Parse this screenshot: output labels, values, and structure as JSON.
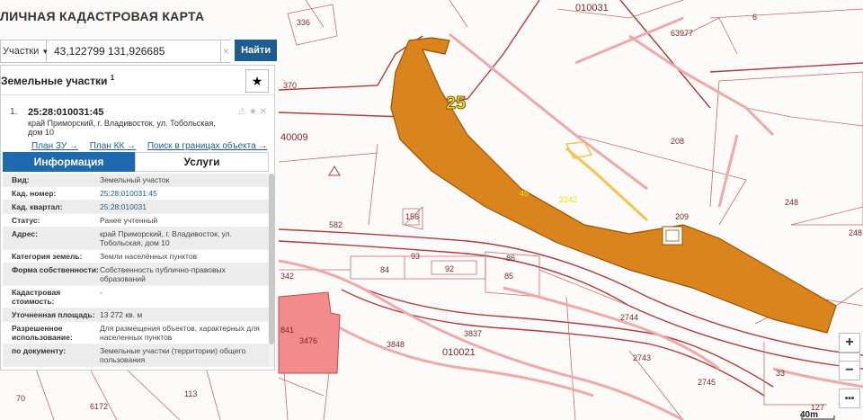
{
  "app": {
    "title": "ЛИЧНАЯ КАДАСТРОВАЯ КАРТА"
  },
  "search": {
    "type_label": "Участки",
    "value": "43,122799 131,926685",
    "button_label": "Найти"
  },
  "panel": {
    "title": "Земельные участки",
    "title_sup": "1",
    "result": {
      "index": "1.",
      "cad_number": "25:28:010031:45",
      "address": "край Приморский, г. Владивосток, ул. Тобольская, дом 10",
      "links": [
        "План ЗУ →",
        "План КК →",
        "Поиск в границах объекта →"
      ]
    },
    "tabs": {
      "info": "Информация",
      "services": "Услуги"
    },
    "attributes": [
      {
        "k": "Вид:",
        "v": "Земельный участок"
      },
      {
        "k": "Кад. номер:",
        "v": "25:28:010031:45"
      },
      {
        "k": "Кад. квартал:",
        "v": "25:28:010031"
      },
      {
        "k": "Статус:",
        "v": "Ранее учтенный"
      },
      {
        "k": "Адрес:",
        "v": "край Приморский, г. Владивосток, ул. Тобольская, дом 10"
      },
      {
        "k": "Категория земель:",
        "v": "Земли населённых пунктов"
      },
      {
        "k": "Форма собственности:",
        "v": "Собственность публично-правовых образований"
      },
      {
        "k": "Кадастровая стоимость:",
        "v": "-"
      },
      {
        "k": "Уточненная площадь:",
        "v": "13 272 кв. м"
      },
      {
        "k": "Разрешенное использование:",
        "v": "Для размещения объектов, характерных для населенных пунктов"
      },
      {
        "k": "по документу:",
        "v": "Земельные участки (территории) общего пользования"
      }
    ]
  },
  "map": {
    "labels": {
      "block_010031": "010031",
      "block_010021": "010021",
      "block_40009": "40009",
      "l25": "25",
      "l45": "45",
      "l3242": "3242",
      "l336": "336",
      "l370": "370",
      "l63977": "63977",
      "l6": "6",
      "l208": "208",
      "l209": "209",
      "l248a": "248",
      "l248b": "248",
      "l582": "582",
      "l156": "156",
      "l84": "84",
      "l93": "93",
      "l92": "92",
      "l86": "86",
      "l85": "85",
      "l342": "342",
      "l841": "841",
      "l3476": "3476",
      "l3848": "3848",
      "l3837": "3837",
      "l2744": "2744",
      "l2743": "2743",
      "l2745": "2745",
      "l33": "33",
      "l127": "127",
      "l70": "70",
      "l6172": "6172",
      "l113": "113"
    },
    "scale": "40m"
  }
}
